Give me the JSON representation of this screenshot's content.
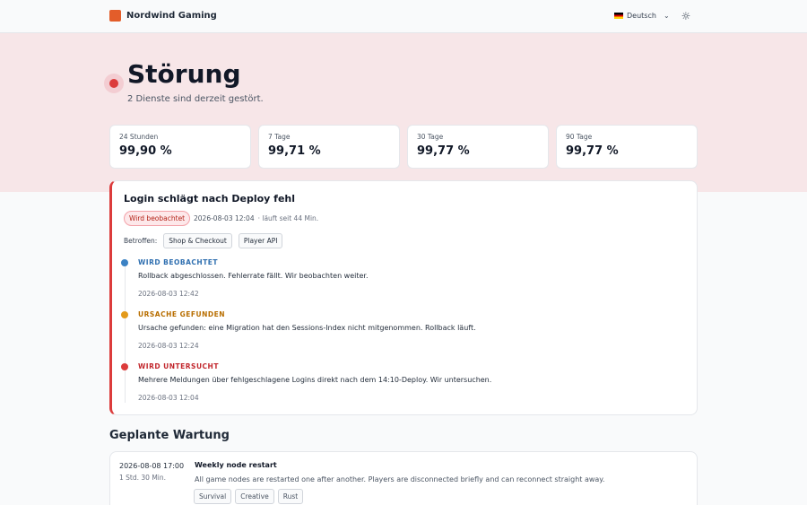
{
  "brand": {
    "name": "Nordwind Gaming",
    "logo_color": "#e35d2a"
  },
  "language": {
    "selected": "Deutsch",
    "flag": "de-flag-icon"
  },
  "theme_toggle": {
    "icon": "sun-icon"
  },
  "hero": {
    "title": "Störung",
    "subtitle": "2 Dienste sind derzeit gestört.",
    "status_color": "#dc3b3b"
  },
  "uptime": [
    {
      "label": "24 Stunden",
      "value": "99,90 %"
    },
    {
      "label": "7 Tage",
      "value": "99,71 %"
    },
    {
      "label": "30 Tage",
      "value": "99,77 %"
    },
    {
      "label": "90 Tage",
      "value": "99,77 %"
    }
  ],
  "incident": {
    "title": "Login schlägt nach Deploy fehl",
    "badge": "Wird beobachtet",
    "started": "2026-08-03 12:04",
    "running_since": "· läuft seit 44 Min.",
    "affected_label": "Betroffen:",
    "affected": [
      "Shop & Checkout",
      "Player API"
    ],
    "updates": [
      {
        "status": "WIRD BEOBACHTET",
        "color": "#2f6fb0",
        "dot": "#3b82c4",
        "text": "Rollback abgeschlossen. Fehlerrate fällt. Wir beobachten weiter.",
        "time": "2026-08-03 12:42"
      },
      {
        "status": "URSACHE GEFUNDEN",
        "color": "#b86e00",
        "dot": "#e39a1a",
        "text": "Ursache gefunden: eine Migration hat den Sessions-Index nicht mitgenommen. Rollback läuft.",
        "time": "2026-08-03 12:24"
      },
      {
        "status": "WIRD UNTERSUCHT",
        "color": "#c2272d",
        "dot": "#dc3b3b",
        "text": "Mehrere Meldungen über fehlgeschlagene Logins direkt nach dem 14:10-Deploy. Wir untersuchen.",
        "time": "2026-08-03 12:04"
      }
    ]
  },
  "maintenance": {
    "heading": "Geplante Wartung",
    "items": [
      {
        "date": "2026-08-08 17:00",
        "duration": "1 Std. 30 Min.",
        "title": "Weekly node restart",
        "description": "All game nodes are restarted one after another. Players are disconnected briefly and can reconnect straight away.",
        "tags": [
          "Survival",
          "Creative",
          "Rust"
        ]
      }
    ]
  }
}
